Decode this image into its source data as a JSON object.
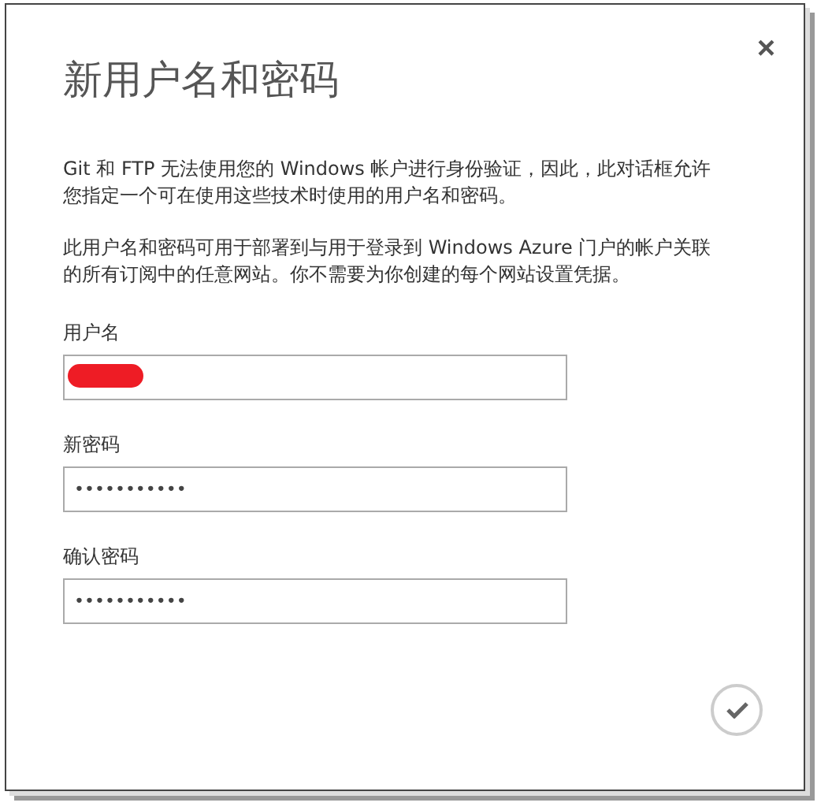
{
  "dialog": {
    "title": "新用户名和密码",
    "close_label": "×"
  },
  "paragraphs": [
    "Git 和 FTP 无法使用您的 Windows 帐户进行身份验证，因此，此对话框允许您指定一个可在使用这些技术时使用的用户名和密码。",
    "此用户名和密码可用于部署到与用于登录到 Windows Azure 门户的帐户关联的所有订阅中的任意网站。你不需要为你创建的每个网站设置凭据。"
  ],
  "fields": [
    {
      "label": "用户名",
      "redacted": true
    },
    {
      "label": "新密码",
      "value": "•••••••••••",
      "redacted": false
    },
    {
      "label": "确认密码",
      "value": "•••••••••••",
      "redacted": false
    }
  ]
}
